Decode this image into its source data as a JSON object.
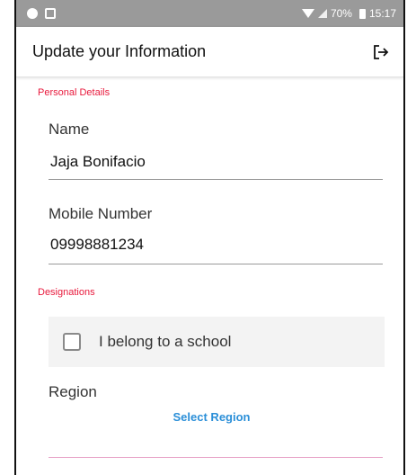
{
  "status_bar": {
    "battery": "70%",
    "time": "15:17"
  },
  "app_bar": {
    "title": "Update your Information"
  },
  "personal_details": {
    "section_label": "Personal Details",
    "name_label": "Name",
    "name_value": "Jaja Bonifacio",
    "mobile_label": "Mobile Number",
    "mobile_value": "09998881234"
  },
  "designations": {
    "section_label": "Designations",
    "school_checkbox_label": "I belong to a school",
    "school_checked": false,
    "region_label": "Region",
    "select_region": "Select Region"
  },
  "colors": {
    "section_accent": "#e8193c",
    "link": "#2b8fd8",
    "status_bar": "#9a9a9a"
  }
}
